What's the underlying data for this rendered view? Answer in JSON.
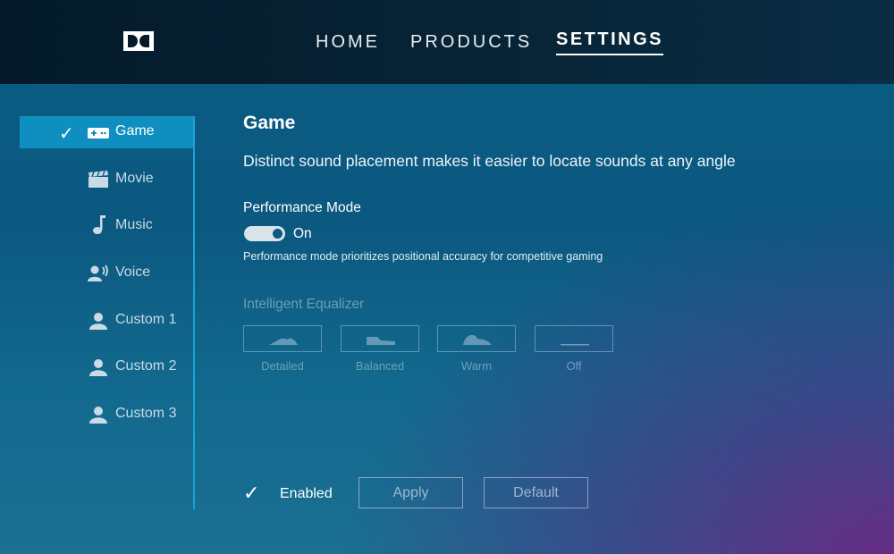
{
  "header": {
    "nav": [
      {
        "label": "HOME",
        "active": false
      },
      {
        "label": "PRODUCTS",
        "active": false
      },
      {
        "label": "SETTINGS",
        "active": true
      }
    ]
  },
  "sidebar": {
    "items": [
      {
        "label": "Game",
        "icon": "gamepad-icon",
        "active": true
      },
      {
        "label": "Movie",
        "icon": "clapperboard-icon",
        "active": false
      },
      {
        "label": "Music",
        "icon": "music-note-icon",
        "active": false
      },
      {
        "label": "Voice",
        "icon": "voice-icon",
        "active": false
      },
      {
        "label": "Custom 1",
        "icon": "user-icon",
        "active": false
      },
      {
        "label": "Custom 2",
        "icon": "user-icon",
        "active": false
      },
      {
        "label": "Custom 3",
        "icon": "user-icon",
        "active": false
      }
    ]
  },
  "main": {
    "title": "Game",
    "description": "Distinct sound placement makes it easier to locate sounds at any angle",
    "performance_mode": {
      "label": "Performance Mode",
      "value": "On",
      "enabled": true,
      "note": "Performance mode prioritizes positional accuracy for competitive gaming"
    },
    "equalizer": {
      "label": "Intelligent Equalizer",
      "options": [
        {
          "label": "Detailed",
          "icon": "eq-detailed-icon"
        },
        {
          "label": "Balanced",
          "icon": "eq-balanced-icon"
        },
        {
          "label": "Warm",
          "icon": "eq-warm-icon"
        },
        {
          "label": "Off",
          "icon": "eq-off-icon"
        }
      ]
    },
    "footer": {
      "enabled_label": "Enabled",
      "apply_label": "Apply",
      "default_label": "Default"
    }
  },
  "colors": {
    "accent": "#0e8fbf",
    "sidebar_line": "#1aa3d6",
    "header_bg": "#072435"
  }
}
